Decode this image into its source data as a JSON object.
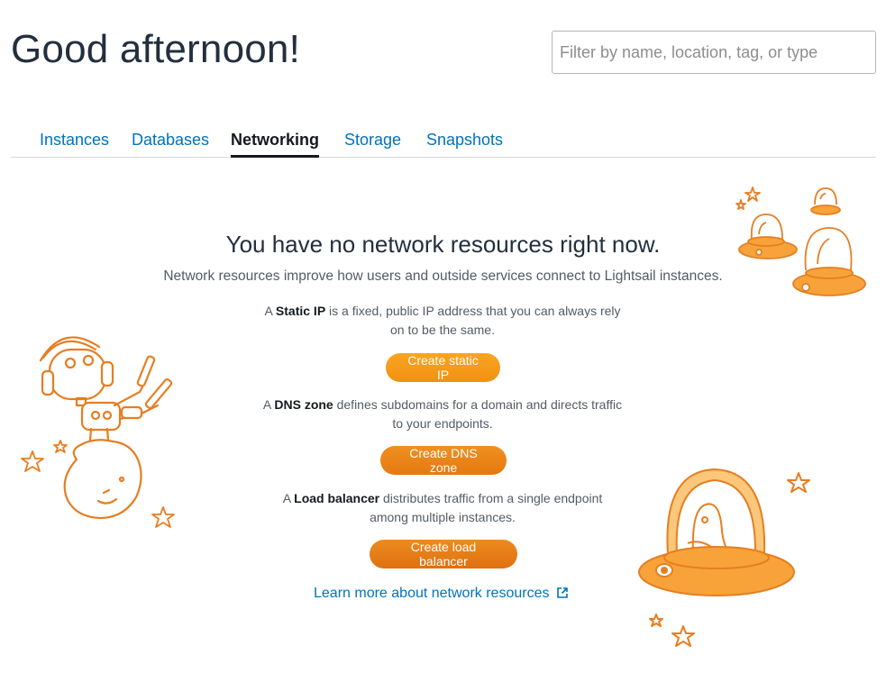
{
  "greeting": "Good afternoon!",
  "search": {
    "placeholder": "Filter by name, location, tag, or type"
  },
  "tabs": [
    {
      "label": "Instances",
      "active": false
    },
    {
      "label": "Databases",
      "active": false
    },
    {
      "label": "Networking",
      "active": true
    },
    {
      "label": "Storage",
      "active": false
    },
    {
      "label": "Snapshots",
      "active": false
    }
  ],
  "empty_state": {
    "headline": "You have no network resources right now.",
    "subline": "Network resources improve how users and outside services connect to Lightsail instances.",
    "static_ip": {
      "pre": "A ",
      "term": "Static IP",
      "post": " is a fixed, public IP address that you can always rely on to be the same.",
      "button": "Create static IP"
    },
    "dns_zone": {
      "pre": "A ",
      "term": "DNS zone",
      "post": " defines subdomains for a domain and directs traffic to your endpoints.",
      "button": "Create DNS zone"
    },
    "load_balancer": {
      "pre": "A ",
      "term": "Load balancer",
      "post": " distributes traffic from a single endpoint among multiple instances.",
      "button": "Create load balancer"
    },
    "learn_more": "Learn more about network resources"
  },
  "icons": {
    "external_link": "external-link-icon",
    "robot": "robot-illustration",
    "spaceships": "spaceship-illustration",
    "stars": "star-icon"
  },
  "colors": {
    "accent": "#ec7211",
    "link": "#0073bb",
    "button_orange": "#f29012",
    "illustration_orange": "#e67e22",
    "illustration_fill": "#f7a33a"
  }
}
